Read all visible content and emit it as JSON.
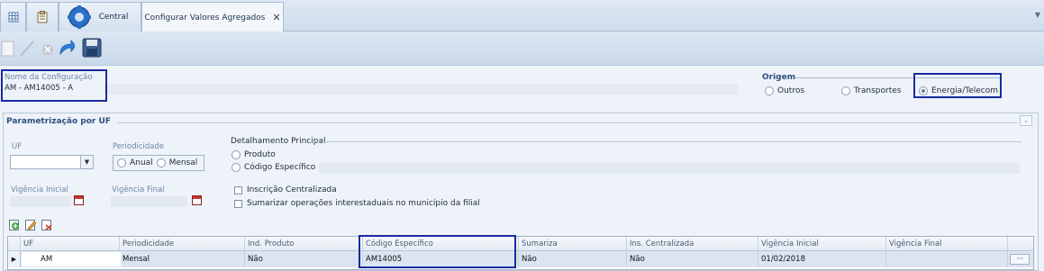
{
  "tabs": [
    {
      "label": "",
      "icon": "grid-icon"
    },
    {
      "label": "",
      "icon": "clipboard-icon"
    },
    {
      "label": "Central",
      "icon": "gear-icon"
    },
    {
      "label": "Configurar Valores Agregados",
      "close": "✕"
    }
  ],
  "toolbar": {
    "icons": [
      "new-icon",
      "edit-icon",
      "delete-icon",
      "undo-icon",
      "save-icon"
    ]
  },
  "config": {
    "label": "Nome da Configuração",
    "value": "AM - AM14005 - A"
  },
  "origem": {
    "title": "Origem",
    "options": [
      {
        "label": "Outros",
        "checked": false
      },
      {
        "label": "Transportes",
        "checked": false
      },
      {
        "label": "Energia/Telecom",
        "checked": true
      }
    ]
  },
  "param": {
    "title": "Parametrização por UF",
    "uf_label": "UF",
    "periodicidade_label": "Periodicidade",
    "periodicidade_options": [
      {
        "label": "Anual",
        "checked": false
      },
      {
        "label": "Mensal",
        "checked": false
      }
    ],
    "vig_inicial_label": "Vigência Inicial",
    "vig_final_label": "Vigência Final",
    "detalhamento_title": "Detalhamento Principal",
    "detalhamento_options": [
      {
        "label": "Produto",
        "checked": false
      },
      {
        "label": "Código Específico",
        "checked": false
      }
    ],
    "checkboxes": [
      {
        "label": "Inscrição Centralizada",
        "checked": false
      },
      {
        "label": "Sumarizar operações interestaduais no município da filial",
        "checked": false
      }
    ]
  },
  "grid": {
    "columns": [
      "UF",
      "Periodicidade",
      "Ind. Produto",
      "Código Específico",
      "Sumariza",
      "Ins. Centralizada",
      "Vigência Inicial",
      "Vigência Final"
    ],
    "rows": [
      [
        "AM",
        "Mensal",
        "Não",
        "AM14005",
        "Não",
        "Não",
        "01/02/2018",
        ""
      ]
    ],
    "ellipsis": "···"
  }
}
